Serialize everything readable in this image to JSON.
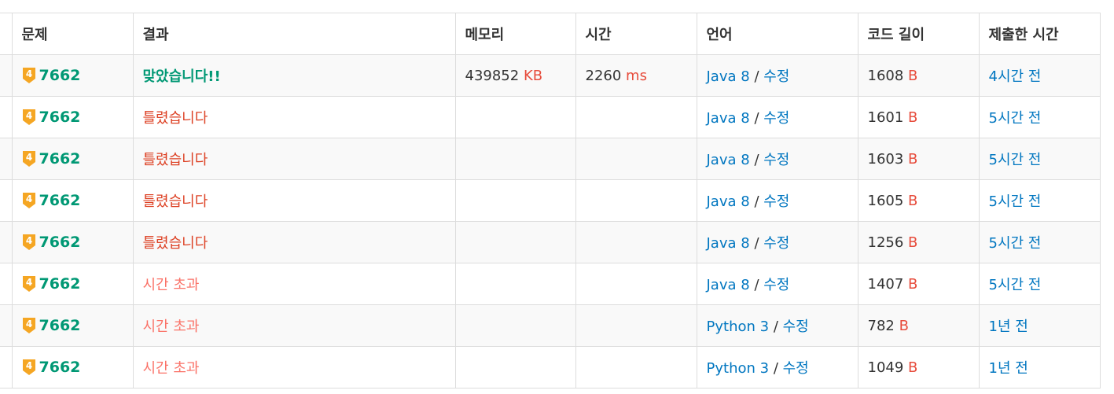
{
  "header": {
    "problem": "문제",
    "result": "결과",
    "memory": "메모리",
    "time": "시간",
    "language": "언어",
    "code_length": "코드 길이",
    "submitted": "제출한 시간"
  },
  "units": {
    "memory": "KB",
    "time": "ms",
    "code": "B"
  },
  "edit_label": "수정",
  "separator": "/",
  "tier_badge": {
    "label": "4",
    "color": "#f5a623"
  },
  "rows": [
    {
      "problem": "7662",
      "result": "맞았습니다!!",
      "result_type": "ac",
      "memory": "439852",
      "time": "2260",
      "language": "Java 8",
      "code_length": "1608",
      "submitted": "4시간 전"
    },
    {
      "problem": "7662",
      "result": "틀렸습니다",
      "result_type": "wa",
      "memory": "",
      "time": "",
      "language": "Java 8",
      "code_length": "1601",
      "submitted": "5시간 전"
    },
    {
      "problem": "7662",
      "result": "틀렸습니다",
      "result_type": "wa",
      "memory": "",
      "time": "",
      "language": "Java 8",
      "code_length": "1603",
      "submitted": "5시간 전"
    },
    {
      "problem": "7662",
      "result": "틀렸습니다",
      "result_type": "wa",
      "memory": "",
      "time": "",
      "language": "Java 8",
      "code_length": "1605",
      "submitted": "5시간 전"
    },
    {
      "problem": "7662",
      "result": "틀렸습니다",
      "result_type": "wa",
      "memory": "",
      "time": "",
      "language": "Java 8",
      "code_length": "1256",
      "submitted": "5시간 전"
    },
    {
      "problem": "7662",
      "result": "시간 초과",
      "result_type": "tle",
      "memory": "",
      "time": "",
      "language": "Java 8",
      "code_length": "1407",
      "submitted": "5시간 전"
    },
    {
      "problem": "7662",
      "result": "시간 초과",
      "result_type": "tle",
      "memory": "",
      "time": "",
      "language": "Python 3",
      "code_length": "782",
      "submitted": "1년 전"
    },
    {
      "problem": "7662",
      "result": "시간 초과",
      "result_type": "tle",
      "memory": "",
      "time": "",
      "language": "Python 3",
      "code_length": "1049",
      "submitted": "1년 전"
    }
  ]
}
